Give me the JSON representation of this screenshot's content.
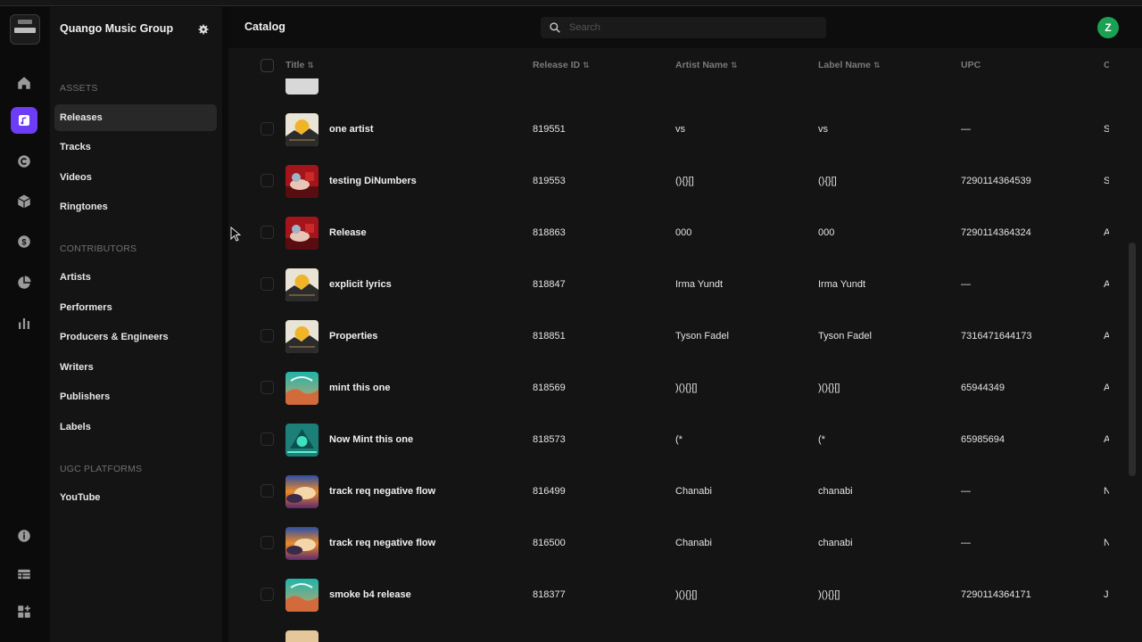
{
  "org_name": "Quango Music Group",
  "sidebar": {
    "sections": [
      {
        "title": "ASSETS",
        "items": [
          "Releases",
          "Tracks",
          "Videos",
          "Ringtones"
        ]
      },
      {
        "title": "CONTRIBUTORS",
        "items": [
          "Artists",
          "Performers",
          "Producers & Engineers",
          "Writers",
          "Publishers",
          "Labels"
        ]
      },
      {
        "title": "UGC PLATFORMS",
        "items": [
          "YouTube"
        ]
      }
    ],
    "active_item": "Releases"
  },
  "rail_icons": [
    "home-icon",
    "releases-icon",
    "copyright-icon",
    "box-icon",
    "dollar-icon",
    "pie-chart-icon",
    "bar-chart-icon",
    "info-icon",
    "table-icon",
    "apps-icon"
  ],
  "header": {
    "title": "Catalog",
    "search_placeholder": "Search",
    "avatar_initial": "Z"
  },
  "table": {
    "columns": [
      "Title",
      "Release ID",
      "Artist Name",
      "Label Name",
      "UPC",
      "C"
    ],
    "sortable": [
      true,
      true,
      true,
      true,
      false,
      false
    ],
    "rows": [
      {
        "title": "one artist",
        "release_id": "819551",
        "artist": "vs",
        "label": "vs",
        "upc": "—",
        "extra": "S",
        "art": "sun-desert"
      },
      {
        "title": "testing DiNumbers",
        "release_id": "819553",
        "artist": "(){}[]",
        "label": "(){}[]",
        "upc": "7290114364539",
        "extra": "S",
        "art": "red-car"
      },
      {
        "title": "Release",
        "release_id": "818863",
        "artist": "000",
        "label": "000",
        "upc": "7290114364324",
        "extra": "A",
        "art": "red-car"
      },
      {
        "title": "explicit lyrics",
        "release_id": "818847",
        "artist": "Irma Yundt",
        "label": "Irma Yundt",
        "upc": "—",
        "extra": "A",
        "art": "sun-desert"
      },
      {
        "title": "Properties",
        "release_id": "818851",
        "artist": "Tyson Fadel",
        "label": "Tyson Fadel",
        "upc": "7316471644173",
        "extra": "A",
        "art": "sun-desert"
      },
      {
        "title": "mint this one",
        "release_id": "818569",
        "artist": ")(){}[]",
        "label": ")(){}[]",
        "upc": "65944349",
        "extra": "A",
        "art": "teal-wave"
      },
      {
        "title": "Now Mint this one",
        "release_id": "818573",
        "artist": "(*",
        "label": "(*",
        "upc": "65985694",
        "extra": "A",
        "art": "teal-pyramid"
      },
      {
        "title": "track req negative flow",
        "release_id": "816499",
        "artist": "Chanabi",
        "label": "chanabi",
        "upc": "—",
        "extra": "N",
        "art": "sunset-cloud"
      },
      {
        "title": "track req negative flow",
        "release_id": "816500",
        "artist": "Chanabi",
        "label": "chanabi",
        "upc": "—",
        "extra": "N",
        "art": "sunset-cloud"
      },
      {
        "title": "smoke b4 release",
        "release_id": "818377",
        "artist": ")(){}[]",
        "label": ")(){}[]",
        "upc": "7290114364171",
        "extra": "J",
        "art": "teal-wave"
      }
    ]
  },
  "colors": {
    "accent": "#6d3cf6",
    "avatar": "#1aa153",
    "background": "#0b0b0b",
    "panel": "#141414"
  }
}
